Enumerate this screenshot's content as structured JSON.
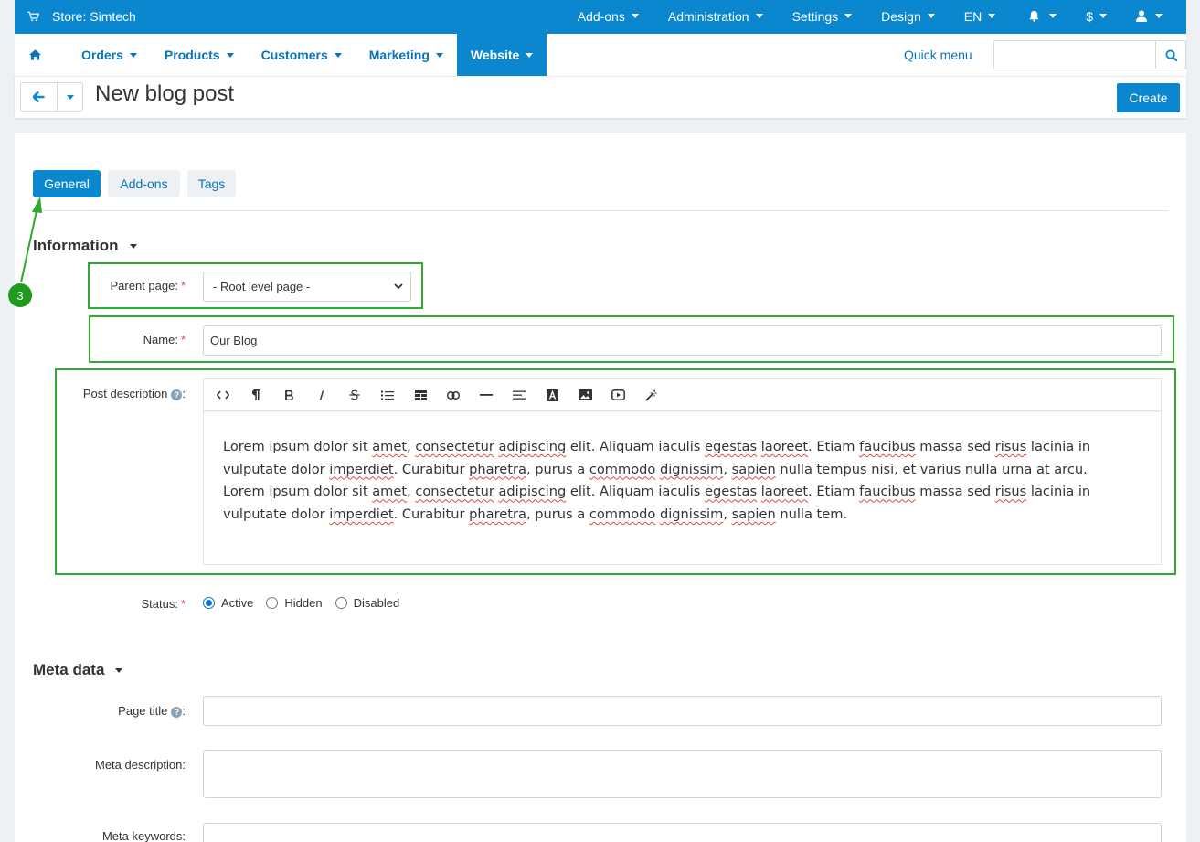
{
  "topbar": {
    "store_label": "Store: Simtech",
    "menus": [
      "Add-ons",
      "Administration",
      "Settings",
      "Design",
      "EN"
    ],
    "currency": "$"
  },
  "nav": {
    "items": [
      "Orders",
      "Products",
      "Customers",
      "Marketing",
      "Website"
    ],
    "active": "Website",
    "quick_menu": "Quick menu",
    "search_placeholder": ""
  },
  "titlebar": {
    "title": "New blog post",
    "create_label": "Create"
  },
  "tabs": [
    "General",
    "Add-ons",
    "Tags"
  ],
  "information": {
    "heading": "Information",
    "parent_label": "Parent page:",
    "parent_value": "- Root level page -",
    "name_label": "Name:",
    "name_value": "Our Blog",
    "description_label": "Post description",
    "description_lines": [
      [
        {
          "t": "Lorem ipsum dolor sit "
        },
        {
          "t": "amet",
          "s": 1
        },
        {
          "t": ", "
        },
        {
          "t": "consectetur",
          "s": 1
        },
        {
          "t": " "
        },
        {
          "t": "adipiscing",
          "s": 1
        },
        {
          "t": " elit. Aliquam iaculis "
        },
        {
          "t": "egestas",
          "s": 1
        },
        {
          "t": " "
        },
        {
          "t": "laoreet",
          "s": 1
        },
        {
          "t": ". Etiam "
        },
        {
          "t": "faucibus",
          "s": 1
        },
        {
          "t": " massa sed "
        },
        {
          "t": "risus",
          "s": 1
        },
        {
          "t": " lacinia in"
        }
      ],
      [
        {
          "t": "vulputate dolor "
        },
        {
          "t": "imperdiet",
          "s": 1
        },
        {
          "t": ". Curabitur "
        },
        {
          "t": "pharetra",
          "s": 1
        },
        {
          "t": ", purus a "
        },
        {
          "t": "commodo",
          "s": 1
        },
        {
          "t": " "
        },
        {
          "t": "dignissim",
          "s": 1
        },
        {
          "t": ", "
        },
        {
          "t": "sapien",
          "s": 1
        },
        {
          "t": " nulla tempus nisi, et varius nulla urna at arcu."
        }
      ],
      [
        {
          "t": "Lorem ipsum dolor sit "
        },
        {
          "t": "amet",
          "s": 1
        },
        {
          "t": ", "
        },
        {
          "t": "consectetur",
          "s": 1
        },
        {
          "t": " "
        },
        {
          "t": "adipiscing",
          "s": 1
        },
        {
          "t": " elit. Aliquam iaculis "
        },
        {
          "t": "egestas",
          "s": 1
        },
        {
          "t": " "
        },
        {
          "t": "laoreet",
          "s": 1
        },
        {
          "t": ". Etiam "
        },
        {
          "t": "faucibus",
          "s": 1
        },
        {
          "t": " massa sed "
        },
        {
          "t": "risus",
          "s": 1
        },
        {
          "t": " lacinia in"
        }
      ],
      [
        {
          "t": "vulputate dolor "
        },
        {
          "t": "imperdiet",
          "s": 1
        },
        {
          "t": ". Curabitur "
        },
        {
          "t": "pharetra",
          "s": 1
        },
        {
          "t": ", purus a "
        },
        {
          "t": "commodo",
          "s": 1
        },
        {
          "t": " "
        },
        {
          "t": "dignissim",
          "s": 1
        },
        {
          "t": ", "
        },
        {
          "t": "sapien",
          "s": 1
        },
        {
          "t": " nulla tem."
        }
      ]
    ],
    "status_label": "Status:",
    "status_options": [
      "Active",
      "Hidden",
      "Disabled"
    ],
    "status_selected": "Active"
  },
  "metadata": {
    "heading": "Meta data",
    "page_title_label": "Page title",
    "meta_description_label": "Meta description:",
    "meta_keywords_label": "Meta keywords:"
  },
  "annotation": {
    "step": "3",
    "color": "#2eaa2e"
  },
  "colors": {
    "primary": "#0a87ce",
    "link": "#0a74b7"
  }
}
